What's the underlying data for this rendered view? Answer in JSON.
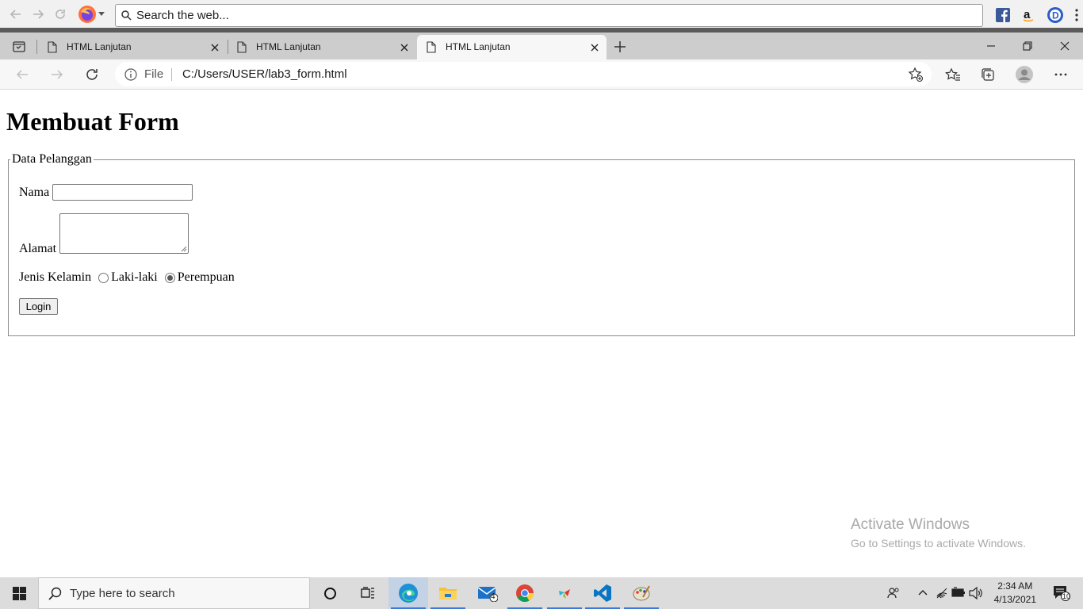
{
  "outer_browser": {
    "search_placeholder": "Search the web..."
  },
  "tabs": [
    {
      "title": "HTML Lanjutan",
      "active": false
    },
    {
      "title": "HTML Lanjutan",
      "active": false
    },
    {
      "title": "HTML Lanjutan",
      "active": true
    }
  ],
  "address_bar": {
    "scheme_label": "File",
    "url": "C:/Users/USER/lab3_form.html"
  },
  "page": {
    "heading": "Membuat Form",
    "fieldset_legend": "Data Pelanggan",
    "nama_label": "Nama",
    "nama_value": "",
    "alamat_label": "Alamat",
    "alamat_value": "",
    "gender_label": "Jenis Kelamin",
    "gender_options": [
      {
        "label": "Laki-laki",
        "checked": false
      },
      {
        "label": "Perempuan",
        "checked": true
      }
    ],
    "login_button": "Login"
  },
  "watermark": {
    "line1": "Activate Windows",
    "line2": "Go to Settings to activate Windows."
  },
  "taskbar": {
    "search_placeholder": "Type here to search",
    "mail_badge": "4",
    "time": "2:34 AM",
    "date": "4/13/2021",
    "notification_count": "10"
  },
  "colors": {
    "accent_blue": "#3b79d6",
    "tab_strip": "#cdcdcd",
    "firefox_orange": "#ff7139"
  }
}
